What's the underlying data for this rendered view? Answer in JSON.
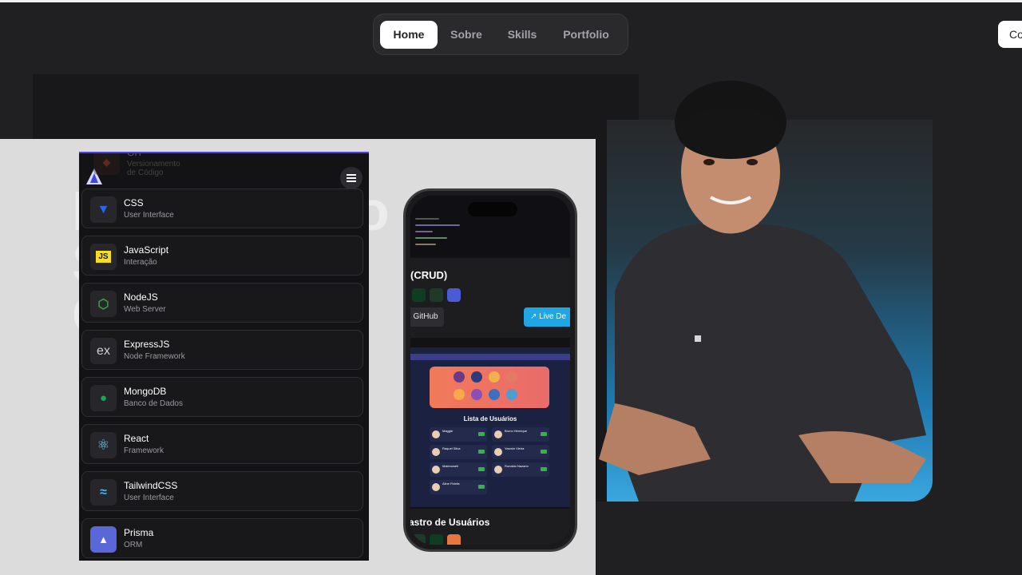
{
  "nav": {
    "items": [
      {
        "label": "Home",
        "active": true
      },
      {
        "label": "Sobre",
        "active": false
      },
      {
        "label": "Skills",
        "active": false
      },
      {
        "label": "Portfolio",
        "active": false
      }
    ],
    "contact_label": "Co"
  },
  "skills": [
    {
      "name": "GIT",
      "subtitle": "Versionamento de Código",
      "icon": "git-icon"
    },
    {
      "name": "CSS",
      "subtitle": "User Interface",
      "icon": "css-icon"
    },
    {
      "name": "JavaScript",
      "subtitle": "Interação",
      "icon": "javascript-icon"
    },
    {
      "name": "NodeJS",
      "subtitle": "Web Server",
      "icon": "nodejs-icon"
    },
    {
      "name": "ExpressJS",
      "subtitle": "Node Framework",
      "icon": "expressjs-icon"
    },
    {
      "name": "MongoDB",
      "subtitle": "Banco de Dados",
      "icon": "mongodb-icon"
    },
    {
      "name": "React",
      "subtitle": "Framework",
      "icon": "react-icon"
    },
    {
      "name": "TailwindCSS",
      "subtitle": "User Interface",
      "icon": "tailwind-icon"
    },
    {
      "name": "Prisma",
      "subtitle": "ORM",
      "icon": "prisma-icon"
    }
  ],
  "phone": {
    "project1_title": "(CRUD)",
    "github_label": "GitHub",
    "live_label": "Live De",
    "list_title": "Lista de Usuários",
    "users": [
      "Maggie",
      "Bruno Henrique",
      "Raquel Silva",
      "Yasmin Vieira",
      "Malenowell",
      "Ronaldo Nazario",
      "Aline Fidelis"
    ],
    "project2_title": "astro de Usuários"
  },
  "colors": {
    "accent": "#1ea7e4",
    "background": "#202022",
    "active_nav": "#ffffff"
  }
}
